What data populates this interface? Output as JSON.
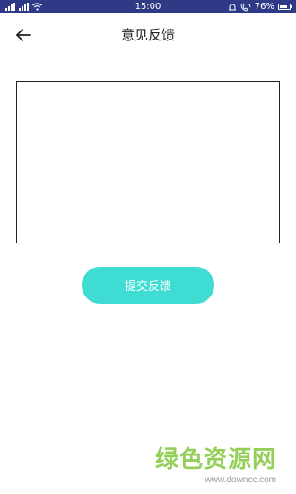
{
  "status_bar": {
    "time": "15:00",
    "battery_percent": "76%",
    "background_color": "#2f3a86"
  },
  "header": {
    "title": "意见反馈",
    "back_icon": "arrow-left-icon"
  },
  "feedback": {
    "value": "",
    "placeholder": ""
  },
  "submit": {
    "label": "提交反馈",
    "color": "#3fdcd3"
  },
  "watermark": {
    "title": "绿色资源网",
    "url": "www.downcc.com",
    "color": "#94cf5a"
  }
}
